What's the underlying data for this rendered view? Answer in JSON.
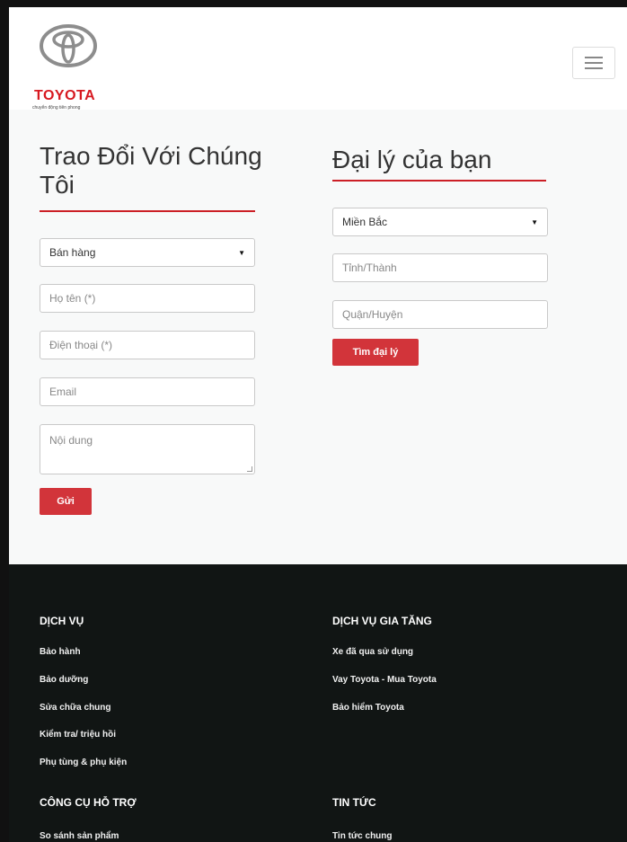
{
  "header": {
    "brand": "TOYOTA",
    "tagline": "chuyển động tiên phong",
    "menu_icon": "hamburger-icon"
  },
  "contact": {
    "title": "Trao Đổi Với Chúng Tôi",
    "title_line1": "Trao Đổi Với Chúng",
    "title_line2": "Tôi",
    "department": "Bán hàng",
    "name_placeholder": "Họ tên (*)",
    "phone_placeholder": "Điện thoại (*)",
    "email_placeholder": "Email",
    "message_placeholder": "Nội dung",
    "submit": "Gửi"
  },
  "dealer": {
    "title": "Đại lý của bạn",
    "region": "Miền Bắc",
    "province_placeholder": "Tỉnh/Thành",
    "district_placeholder": "Quận/Huyện",
    "search": "Tìm đại lý"
  },
  "footer": {
    "services": {
      "heading": "DỊCH VỤ",
      "links": [
        "Bảo hành",
        "Bảo dưỡng",
        "Sửa chữa chung",
        "Kiểm tra/ triệu hồi",
        "Phụ tùng & phụ kiện"
      ]
    },
    "value_added": {
      "heading": "DỊCH VỤ GIA TĂNG",
      "links": [
        "Xe đã qua sử dụng",
        "Vay Toyota - Mua Toyota",
        "Bảo hiểm Toyota"
      ]
    },
    "tools": {
      "heading": "CÔNG CỤ HỖ TRỢ",
      "links": [
        "So sánh sản phẩm"
      ]
    },
    "news": {
      "heading": "TIN TỨC",
      "links": [
        "Tin tức chung"
      ]
    }
  },
  "colors": {
    "accent": "#d2343a",
    "footer_bg": "#111514"
  }
}
